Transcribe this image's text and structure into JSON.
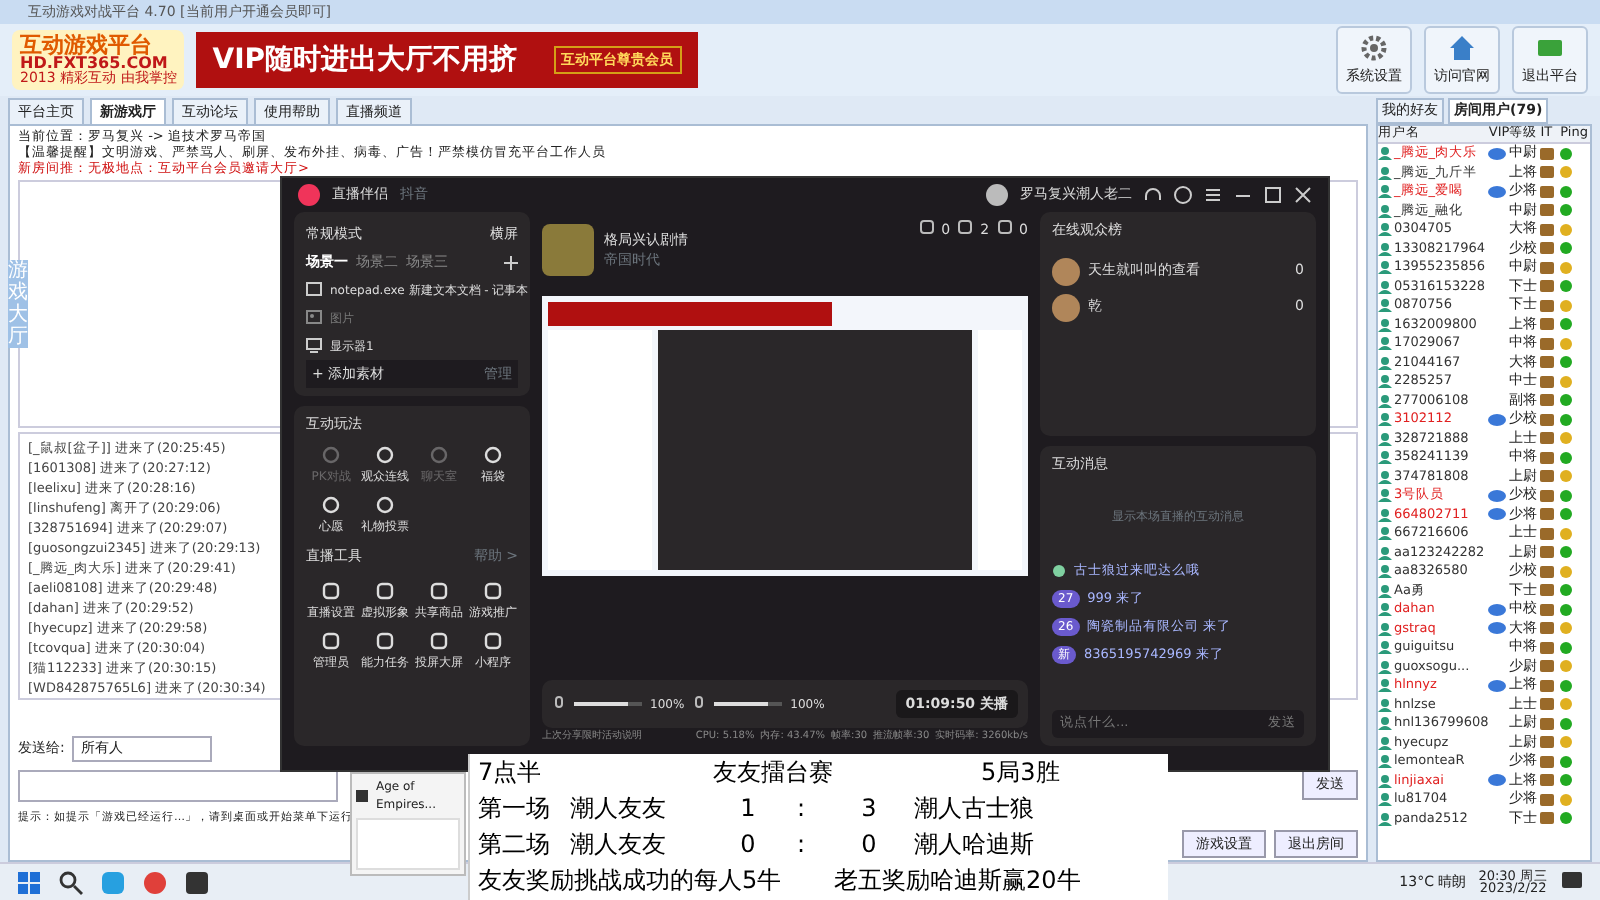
{
  "window": {
    "title": "互动游戏对战平台 4.70 [当前用户开通会员即可]"
  },
  "header": {
    "logo_title": "互动游戏平台",
    "logo_url": "HD.FXT365.COM",
    "logo_slogan": "2013 精彩互动 由我掌控",
    "banner": "VIP随时进出大厅不用挤",
    "banner_badge": "互动平台尊贵会员",
    "buttons": [
      {
        "label": "系统设置",
        "kind": "gear"
      },
      {
        "label": "访问官网",
        "kind": "home"
      },
      {
        "label": "退出平台",
        "kind": "exit"
      }
    ]
  },
  "tabs": [
    {
      "label": "平台主页",
      "selected": false
    },
    {
      "label": "新游戏厅",
      "selected": true
    },
    {
      "label": "互动论坛",
      "selected": false
    },
    {
      "label": "使用帮助",
      "selected": false
    },
    {
      "label": "直播频道",
      "selected": false
    }
  ],
  "breadcrumb": "当前位置：罗马复兴 -> 追技术罗马帝国",
  "notice": "【温馨提醒】文明游戏、严禁骂人、刷屏、发布外挂、病毒、广告！严禁模仿冒充平台工作人员",
  "announcement": "新房间推：无极地点：互动平台会员邀请大厅>",
  "side_tab": "游戏大厅",
  "chat_log": [
    "[_鼠叔[盆子]] 进来了(20:25:45)",
    "[1601308] 进来了(20:27:12)",
    "[leelixu] 进来了(20:28:16)",
    "[linshufeng] 离开了(20:29:06)",
    "[328751694] 进来了(20:29:07)",
    "[guosongzui2345] 进来了(20:29:13)",
    "[_腾远_肉大乐] 进来了(20:29:41)",
    "[aeli08108] 进来了(20:29:48)",
    "[dahan] 进来了(20:29:52)",
    "[hyecupz] 进来了(20:29:58)",
    "[tcovqua] 进来了(20:30:04)",
    "[猫112233] 进来了(20:30:15)",
    "[WD842875765L6] 进来了(20:30:34)"
  ],
  "send_to": {
    "label": "发送给:",
    "value": "所有人"
  },
  "tip": "提示：如提示「游戏已经运行…」，请到桌面或开始菜单下运行",
  "buttons": [
    "发送",
    "游戏设置",
    "退出房间"
  ],
  "user_panel": {
    "tabs": [
      {
        "label": "我的好友",
        "selected": false
      },
      {
        "label": "房间用户(79)",
        "selected": true
      }
    ],
    "columns": [
      "用户名",
      "VIP",
      "等级",
      "IT",
      "Ping"
    ],
    "rows": [
      {
        "name": "_腾远_肉大乐",
        "vip": true,
        "rank": "中尉",
        "color": "#22aa22"
      },
      {
        "name": "_腾远_九斤半",
        "vip": false,
        "rank": "上将",
        "color": "#e0b020"
      },
      {
        "name": "_腾远_爱喝",
        "vip": true,
        "rank": "少将",
        "color": "#22aa22"
      },
      {
        "name": "_腾远_融化",
        "vip": false,
        "rank": "中尉",
        "color": "#22aa22"
      },
      {
        "name": "0304705",
        "vip": false,
        "rank": "大将",
        "color": "#e0b020"
      },
      {
        "name": "13308217964",
        "vip": false,
        "rank": "少校",
        "color": "#22aa22"
      },
      {
        "name": "13955235856",
        "vip": false,
        "rank": "中尉",
        "color": "#e0b020"
      },
      {
        "name": "05316153228",
        "vip": false,
        "rank": "下士",
        "color": "#22aa22"
      },
      {
        "name": "0870756",
        "vip": false,
        "rank": "下士",
        "color": "#e0b020"
      },
      {
        "name": "1632009800",
        "vip": false,
        "rank": "上将",
        "color": "#22aa22"
      },
      {
        "name": "17029067",
        "vip": false,
        "rank": "中将",
        "color": "#e0b020"
      },
      {
        "name": "21044167",
        "vip": false,
        "rank": "大将",
        "color": "#22aa22"
      },
      {
        "name": "2285257",
        "vip": false,
        "rank": "中士",
        "color": "#e0b020"
      },
      {
        "name": "277006108",
        "vip": false,
        "rank": "副将",
        "color": "#22aa22"
      },
      {
        "name": "3102112",
        "vip": true,
        "rank": "少校",
        "color": "#22aa22"
      },
      {
        "name": "328721888",
        "vip": false,
        "rank": "上士",
        "color": "#e0b020"
      },
      {
        "name": "358241139",
        "vip": false,
        "rank": "中将",
        "color": "#22aa22"
      },
      {
        "name": "374781808",
        "vip": false,
        "rank": "上尉",
        "color": "#e0b020"
      },
      {
        "name": "3号队员",
        "vip": true,
        "rank": "少校",
        "color": "#22aa22"
      },
      {
        "name": "664802711",
        "vip": true,
        "rank": "少将",
        "color": "#22aa22"
      },
      {
        "name": "667216606",
        "vip": false,
        "rank": "上士",
        "color": "#e0b020"
      },
      {
        "name": "aa123242282",
        "vip": false,
        "rank": "上尉",
        "color": "#22aa22"
      },
      {
        "name": "aa8326580",
        "vip": false,
        "rank": "少校",
        "color": "#e0b020"
      },
      {
        "name": "Aa勇",
        "vip": false,
        "rank": "下士",
        "color": "#22aa22"
      },
      {
        "name": "dahan",
        "vip": true,
        "rank": "中校",
        "color": "#22aa22"
      },
      {
        "name": "gstraq",
        "vip": true,
        "rank": "大将",
        "color": "#e0b020"
      },
      {
        "name": "guiguitsu",
        "vip": false,
        "rank": "中将",
        "color": "#22aa22"
      },
      {
        "name": "guoxsogu...",
        "vip": false,
        "rank": "少尉",
        "color": "#e0b020"
      },
      {
        "name": "hlnnyz",
        "vip": true,
        "rank": "上将",
        "color": "#22aa22"
      },
      {
        "name": "hnlzse",
        "vip": false,
        "rank": "上士",
        "color": "#e0b020"
      },
      {
        "name": "hnl136799608",
        "vip": false,
        "rank": "上尉",
        "color": "#22aa22"
      },
      {
        "name": "hyecupz",
        "vip": false,
        "rank": "上尉",
        "color": "#e0b020"
      },
      {
        "name": "lemonteaR",
        "vip": false,
        "rank": "少将",
        "color": "#22aa22"
      },
      {
        "name": "linjiaxai",
        "vip": true,
        "rank": "上将",
        "color": "#22aa22"
      },
      {
        "name": "lu81704",
        "vip": false,
        "rank": "少将",
        "color": "#e0b020"
      },
      {
        "name": "panda2512",
        "vip": false,
        "rank": "下士",
        "color": "#22aa22"
      }
    ]
  },
  "stream_app": {
    "title": "直播伴侣",
    "platform": "抖音",
    "user": "罗马复兴潮人老二",
    "mode": "常规模式",
    "orientation": "横屏",
    "scenes": [
      {
        "label": "场景一",
        "selected": true
      },
      {
        "label": "场景二",
        "selected": false
      },
      {
        "label": "场景三",
        "selected": false
      }
    ],
    "sources": [
      {
        "label": "notepad.exe 新建文本文档 - 记事本",
        "kind": "window",
        "visible": true
      },
      {
        "label": "图片",
        "kind": "image",
        "visible": false
      },
      {
        "label": "显示器1",
        "kind": "monitor",
        "visible": true
      }
    ],
    "add_source": "+ 添加素材",
    "manage": "管理",
    "interact_title": "互动玩法",
    "interact_tools": [
      {
        "label": "PK对战",
        "disabled": true
      },
      {
        "label": "观众连线",
        "disabled": false
      },
      {
        "label": "聊天室",
        "disabled": true
      },
      {
        "label": "福袋",
        "disabled": false
      },
      {
        "label": "心愿",
        "disabled": false
      },
      {
        "label": "礼物投票",
        "disabled": false
      }
    ],
    "tools_title": "直播工具",
    "help": "帮助 >",
    "tools": [
      "直播设置",
      "虚拟形象",
      "共享商品",
      "游戏推广",
      "管理员",
      "能力任务",
      "投屏大屏",
      "小程序"
    ],
    "room_title": "格局兴认剧情",
    "room_category": "帝国时代",
    "stats": [
      "0",
      "2",
      "0"
    ],
    "mic": {
      "level": 0.78,
      "reading": "100%"
    },
    "speaker": {
      "level": 0.78,
      "reading": "100%"
    },
    "timer": "01:09:50",
    "stop": "关播",
    "status": [
      "CPU: 5.18%",
      "内存: 43.47%",
      "帧率:30",
      "推流帧率:30",
      "实时码率: 3260kb/s"
    ],
    "footer_link": "上次分享限时活动说明",
    "viewers_title": "在线观众榜",
    "viewers": [
      {
        "name": "天生就叫叫的查看",
        "score": "0"
      },
      {
        "name": "乾",
        "score": "0"
      }
    ],
    "messages_title": "互动消息",
    "messages_placeholder": "显示本场直播的互动消息",
    "messages": [
      {
        "text": "古士狼过来吧达么哦"
      },
      {
        "badge": "27",
        "text": "999 来了"
      },
      {
        "badge": "26",
        "text": "陶瓷制品有限公司 来了"
      },
      {
        "badge": "新",
        "text": "8365195742969 来了"
      }
    ],
    "input_placeholder": "说点什么...",
    "send": "发送"
  },
  "scoreboard": {
    "lines": [
      {
        "kind": "header",
        "texts": [
          "7点半",
          "友友擂台赛",
          "5局3胜"
        ]
      },
      {
        "kind": "match",
        "texts": [
          "第一场",
          "潮人友友",
          "1",
          ":",
          "3",
          "潮人古士狼"
        ]
      },
      {
        "kind": "match",
        "texts": [
          "第二场",
          "潮人友友",
          "0",
          ":",
          "0",
          "潮人哈迪斯"
        ]
      },
      {
        "kind": "reward",
        "texts": [
          "友友奖励挑战成功的每人5牛",
          "老五奖励哈迪斯赢20牛"
        ]
      }
    ]
  },
  "thumbnail": {
    "title": "Age of Empires..."
  },
  "taskbar": {
    "weather": "13°C 晴朗",
    "time": "20:30 周三",
    "date": "2023/2/22"
  }
}
